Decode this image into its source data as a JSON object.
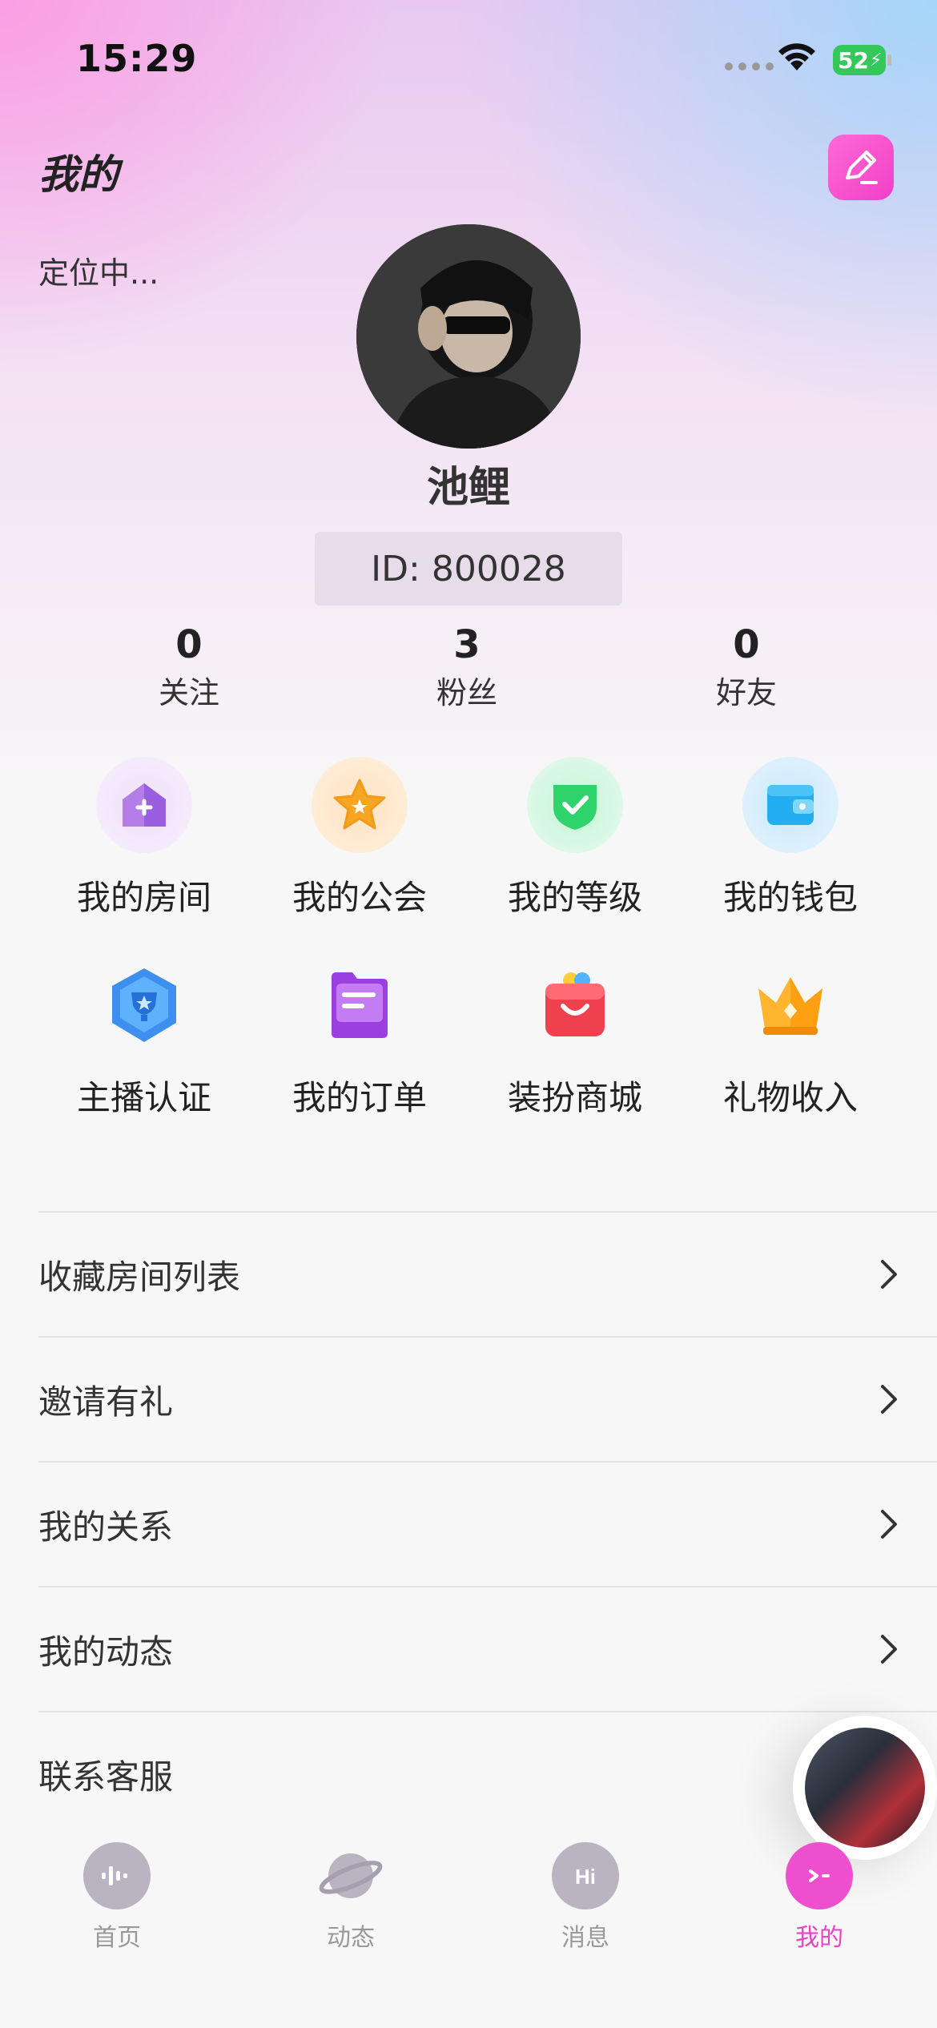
{
  "status_bar": {
    "time": "15:29",
    "battery": "52"
  },
  "header": {
    "title": "我的",
    "edit_icon": "edit-icon"
  },
  "profile": {
    "location": "定位中...",
    "nickname": "池鲤",
    "id_text": "ID: 800028"
  },
  "stats": [
    {
      "value": "0",
      "label": "关注"
    },
    {
      "value": "3",
      "label": "粉丝"
    },
    {
      "value": "0",
      "label": "好友"
    }
  ],
  "grid": [
    {
      "label": "我的房间",
      "icon": "room-icon"
    },
    {
      "label": "我的公会",
      "icon": "star-guild-icon"
    },
    {
      "label": "我的等级",
      "icon": "level-shield-icon"
    },
    {
      "label": "我的钱包",
      "icon": "wallet-icon"
    },
    {
      "label": "主播认证",
      "icon": "anchor-badge-icon"
    },
    {
      "label": "我的订单",
      "icon": "order-icon"
    },
    {
      "label": "装扮商城",
      "icon": "shop-bag-icon"
    },
    {
      "label": "礼物收入",
      "icon": "crown-icon"
    }
  ],
  "menu": [
    {
      "label": "收藏房间列表"
    },
    {
      "label": "邀请有礼"
    },
    {
      "label": "我的关系"
    },
    {
      "label": "我的动态"
    },
    {
      "label": "联系客服"
    }
  ],
  "tabs": [
    {
      "label": "首页",
      "icon": "home-voice-icon"
    },
    {
      "label": "动态",
      "icon": "planet-icon"
    },
    {
      "label": "消息",
      "icon": "message-hi-icon"
    },
    {
      "label": "我的",
      "icon": "profile-face-icon"
    }
  ],
  "colors": {
    "accent": "#e843c4",
    "battery": "#34c759"
  }
}
